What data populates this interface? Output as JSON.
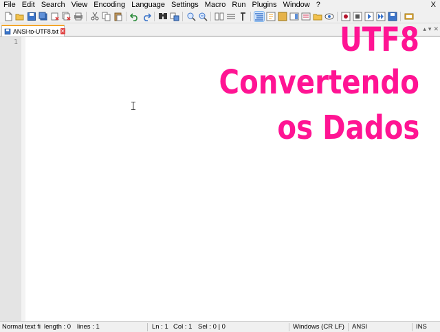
{
  "menu": {
    "items": [
      "File",
      "Edit",
      "Search",
      "View",
      "Encoding",
      "Language",
      "Settings",
      "Macro",
      "Run",
      "Plugins",
      "Window",
      "?"
    ],
    "close": "X"
  },
  "toolbar": {
    "icons": [
      "new-file-icon",
      "open-file-icon",
      "save-icon",
      "save-all-icon",
      "close-icon",
      "close-all-icon",
      "print-icon",
      "cut-icon",
      "copy-icon",
      "paste-icon",
      "undo-icon",
      "redo-icon",
      "find-icon",
      "replace-icon",
      "zoom-in-icon",
      "zoom-out-icon",
      "sync-vertical-icon",
      "sync-horizontal-icon",
      "word-wrap-icon",
      "show-all-chars-icon",
      "indent-guide-icon",
      "user-language-icon",
      "doc-map-icon",
      "function-list-icon",
      "folder-as-workspace-icon",
      "monitoring-icon",
      "record-macro-icon",
      "stop-macro-icon",
      "play-macro-icon",
      "run-macro-multiple-icon",
      "save-macro-icon",
      "plugin-icon"
    ],
    "accent": "#3b74c9"
  },
  "tab": {
    "label": "ANSI-to-UTF8.txt",
    "close": "✕",
    "accent": "#f3a62c"
  },
  "editor": {
    "line_number": "1",
    "overlay": {
      "line1": "UTF8",
      "line2": "Convertendo",
      "line3": "os Dados",
      "color": "#ff1493"
    }
  },
  "status": {
    "type": "Normal text fi",
    "length": "length : 0",
    "lines": "lines : 1",
    "ln": "Ln : 1",
    "col": "Col : 1",
    "sel": "Sel : 0 | 0",
    "eol": "Windows (CR LF)",
    "encoding": "ANSI",
    "mode": "INS"
  }
}
